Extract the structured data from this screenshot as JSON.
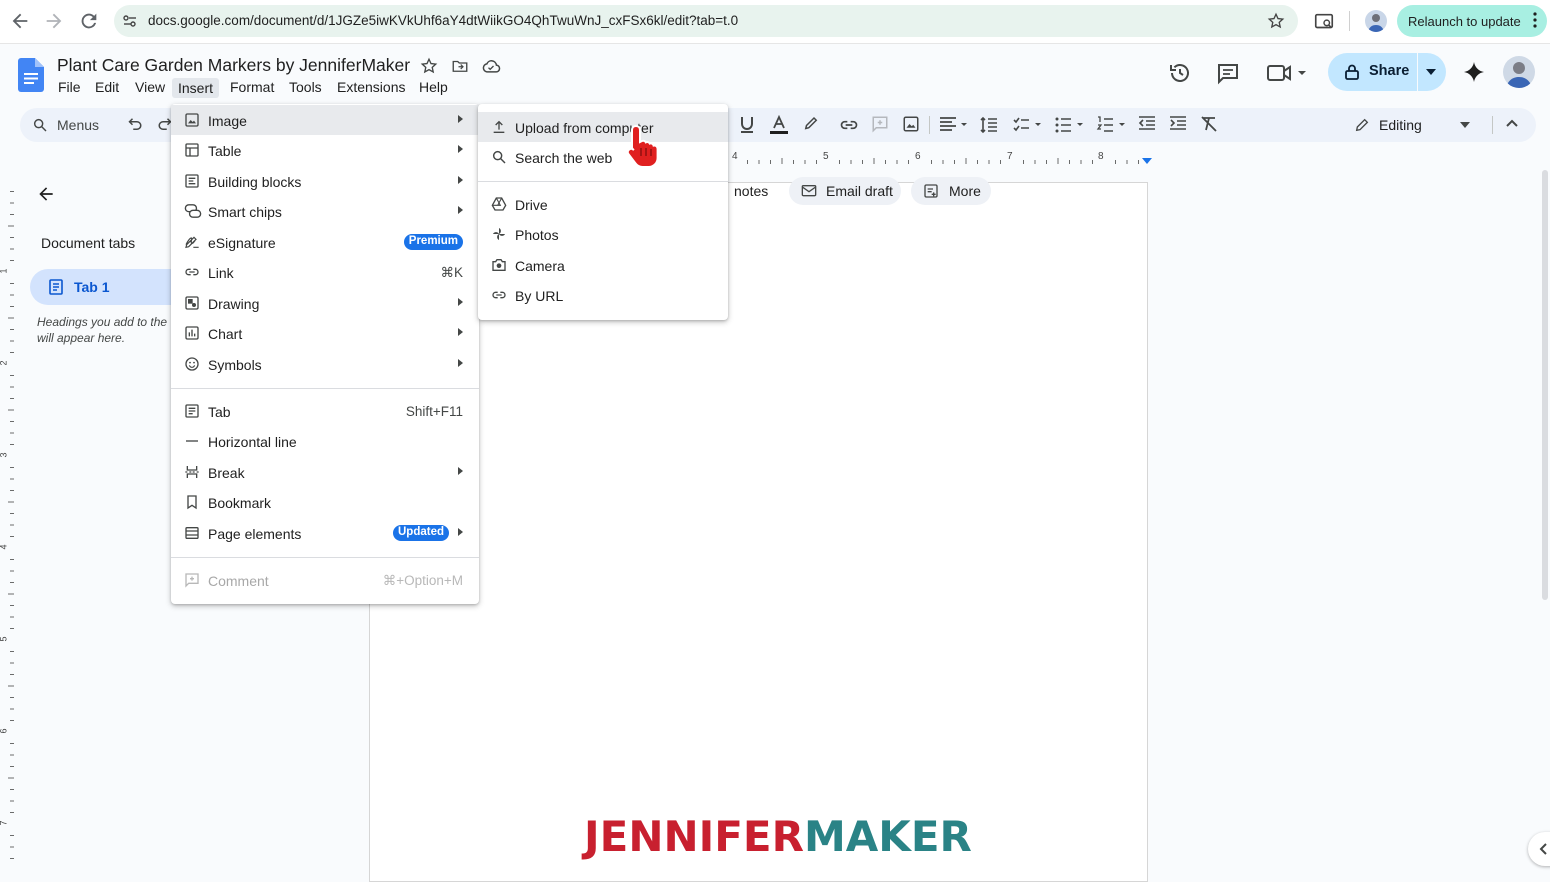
{
  "browser": {
    "url": "docs.google.com/document/d/1JGZe5iwKVkUhf6aY4dtWiikGO4QhTwuWnJ_cxFSx6kl/edit?tab=t.0",
    "relaunch_label": "Relaunch to update"
  },
  "doc": {
    "title": "Plant Care Garden Markers by JenniferMaker",
    "menu": [
      "File",
      "Edit",
      "View",
      "Insert",
      "Format",
      "Tools",
      "Extensions",
      "Help"
    ],
    "share_label": "Share",
    "menus_search_label": "Menus",
    "editing_label": "Editing"
  },
  "ruler": {
    "ticks": [
      "4",
      "5",
      "6",
      "7",
      "8"
    ]
  },
  "left_ruler": {
    "ticks": [
      "1",
      "2",
      "3",
      "4",
      "5",
      "6",
      "7"
    ]
  },
  "outline": {
    "heading": "Document tabs",
    "tab_label": "Tab 1",
    "hint_line1": "Headings you add to the",
    "hint_line2": "will appear here."
  },
  "chips": {
    "notes": "notes",
    "email_draft": "Email draft",
    "more": "More"
  },
  "insert_menu": {
    "items": [
      {
        "label": "Image"
      },
      {
        "label": "Table"
      },
      {
        "label": "Building blocks"
      },
      {
        "label": "Smart chips"
      },
      {
        "label": "eSignature",
        "badge": "Premium"
      },
      {
        "label": "Link",
        "shortcut": "⌘K"
      },
      {
        "label": "Drawing"
      },
      {
        "label": "Chart"
      },
      {
        "label": "Symbols"
      },
      {
        "label": "Tab",
        "shortcut": "Shift+F11"
      },
      {
        "label": "Horizontal line"
      },
      {
        "label": "Break"
      },
      {
        "label": "Bookmark"
      },
      {
        "label": "Page elements",
        "badge": "Updated"
      },
      {
        "label": "Comment",
        "shortcut": "⌘+Option+M"
      }
    ]
  },
  "image_submenu": {
    "items": [
      {
        "label": "Upload from computer"
      },
      {
        "label": "Search the web"
      },
      {
        "label": "Drive"
      },
      {
        "label": "Photos"
      },
      {
        "label": "Camera"
      },
      {
        "label": "By URL"
      }
    ]
  },
  "watermark": {
    "part1": "JENNIFER",
    "part2": "MAKER",
    "color1": "#c8202f",
    "color2": "#2a8386"
  },
  "colors": {
    "accent": "#1a73e8",
    "share_bg": "#c2e7ff",
    "tab_bg": "#d3e3fd",
    "relaunch_bg": "#a8efe2"
  }
}
